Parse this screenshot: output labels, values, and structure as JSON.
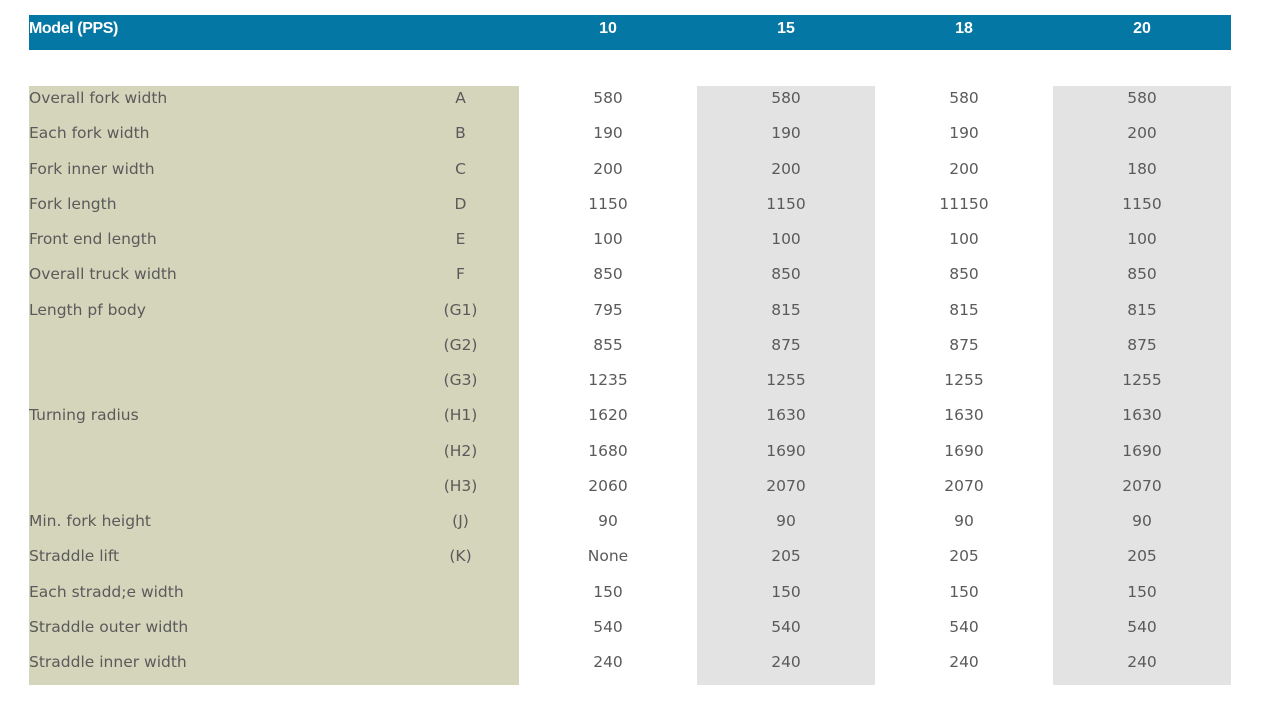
{
  "header": {
    "model_label": "Model (PPS)",
    "models": [
      "10",
      "15",
      "18",
      "20"
    ]
  },
  "rows": [
    {
      "label": "Overall fork width",
      "code": "A",
      "values": [
        "580",
        "580",
        "580",
        "580"
      ]
    },
    {
      "label": "Each fork width",
      "code": "B",
      "values": [
        "190",
        "190",
        "190",
        "200"
      ]
    },
    {
      "label": "Fork inner width",
      "code": "C",
      "values": [
        "200",
        "200",
        "200",
        "180"
      ]
    },
    {
      "label": "Fork length",
      "code": "D",
      "values": [
        "1150",
        "1150",
        "11150",
        "1150"
      ]
    },
    {
      "label": "Front end length",
      "code": "E",
      "values": [
        "100",
        "100",
        "100",
        "100"
      ]
    },
    {
      "label": "Overall truck width",
      "code": "F",
      "values": [
        "850",
        "850",
        "850",
        "850"
      ]
    },
    {
      "label": "Length pf body",
      "code": "(G1)",
      "values": [
        "795",
        "815",
        "815",
        "815"
      ]
    },
    {
      "label": "",
      "code": "(G2)",
      "values": [
        "855",
        "875",
        "875",
        "875"
      ]
    },
    {
      "label": "",
      "code": "(G3)",
      "values": [
        "1235",
        "1255",
        "1255",
        "1255"
      ]
    },
    {
      "label": "Turning radius",
      "code": "(H1)",
      "values": [
        "1620",
        "1630",
        "1630",
        "1630"
      ]
    },
    {
      "label": "",
      "code": "(H2)",
      "values": [
        "1680",
        "1690",
        "1690",
        "1690"
      ]
    },
    {
      "label": "",
      "code": "(H3)",
      "values": [
        "2060",
        "2070",
        "2070",
        "2070"
      ]
    },
    {
      "label": "Min. fork height",
      "code": "(J)",
      "values": [
        "90",
        "90",
        "90",
        "90"
      ]
    },
    {
      "label": "Straddle lift",
      "code": "(K)",
      "values": [
        "None",
        "205",
        "205",
        "205"
      ]
    },
    {
      "label": "Each stradd;e width",
      "code": "",
      "values": [
        "150",
        "150",
        "150",
        "150"
      ]
    },
    {
      "label": "Straddle outer width",
      "code": "",
      "values": [
        "540",
        "540",
        "540",
        "540"
      ]
    },
    {
      "label": "Straddle inner width",
      "code": "",
      "values": [
        "240",
        "240",
        "240",
        "240"
      ]
    }
  ]
}
